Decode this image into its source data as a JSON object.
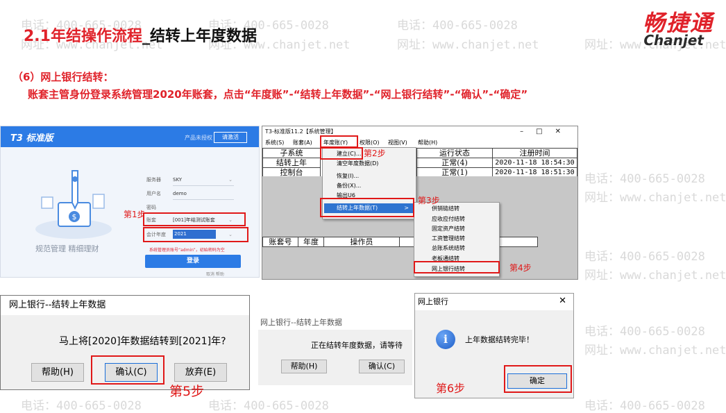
{
  "slide": {
    "title_prefix": "2.1年结操作流程",
    "title_suffix": "_结转上年度数据",
    "section": "（6）网上银行结转：",
    "description": "账套主管身份登录系统管理2020年账套，点击“年度账”-“结转上年数据”-“网上银行结转”-“确认”-“确定”"
  },
  "logo": {
    "cn": "畅捷通",
    "en": "Chanjet"
  },
  "watermark": {
    "phone": "电话：400-665-0028",
    "url": "网址：www.chanjet.net"
  },
  "login": {
    "brand": "T3 标准版",
    "product_note": "产品未授权",
    "login_link": "请激活",
    "slogan": "规范管理  精细理财",
    "fields": [
      {
        "label": "服务器",
        "value": "SKY"
      },
      {
        "label": "用户名",
        "value": "demo"
      },
      {
        "label": "密码",
        "value": ""
      },
      {
        "label": "账套",
        "value": "[001]年结测试账套"
      }
    ],
    "year_label": "会计年度",
    "year_value": "2021",
    "hint": "系统管理员账号“admin”，初始密码为空",
    "login_button": "登录",
    "footer": "取消    帮助"
  },
  "steps": {
    "s1": "第1步",
    "s2": "第2步",
    "s3": "第3步",
    "s4": "第4步",
    "s5": "第5步",
    "s6": "第6步"
  },
  "t3": {
    "title": "T3-标准版11.2【系统管理】",
    "menus": [
      "系统(S)",
      "账套(A)",
      "年度账(Y)",
      "权限(O)",
      "视图(V)",
      "帮助(H)"
    ],
    "left_rows": [
      "子系统",
      "结转上年",
      "控制台"
    ],
    "headers": {
      "status": "运行状态",
      "time": "注册时间"
    },
    "rows": [
      {
        "status": "正常(4)",
        "time": "2020-11-18 18:54:30"
      },
      {
        "status": "正常(1)",
        "time": "2020-11-18 18:51:30"
      }
    ],
    "bottom_headers": [
      "账套号",
      "年度",
      "操作员"
    ],
    "year_menu": [
      "建立(C)...",
      "清空年度数据(D)",
      "恢复(I)...",
      "备份(X)...",
      "输出U6",
      "结转上年数据(T)"
    ],
    "sub_menu": [
      "供销链结转",
      "应收应付结转",
      "固定资产结转",
      "工资管理结转",
      "总账系统结转",
      "老板通结转",
      "网上银行结转"
    ]
  },
  "dialog_confirm": {
    "title": "网上银行--结转上年数据",
    "message": "马上将[2020]年数据结转到[2021]年?",
    "help": "帮助(H)",
    "ok": "确认(C)",
    "cancel": "放弃(E)"
  },
  "dialog_progress": {
    "title": "网上银行--结转上年数据",
    "message": "正在结转年度数据，请等待",
    "help": "帮助(H)",
    "ok": "确认(C)"
  },
  "dialog_done": {
    "title": "网上银行",
    "message": "上年数据结转完毕！",
    "ok": "确定"
  }
}
